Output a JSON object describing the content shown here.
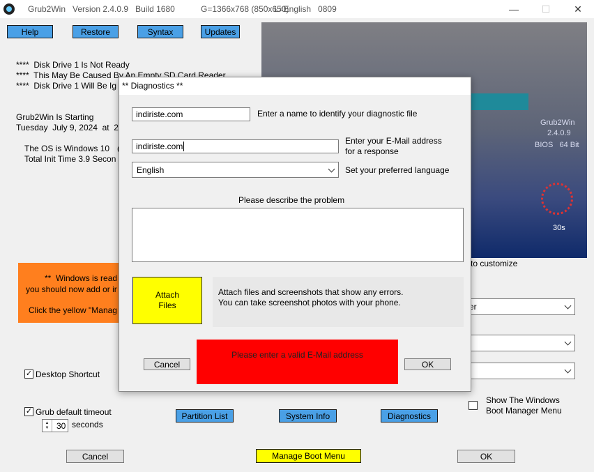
{
  "window": {
    "title": "Grub2Win   Version 2.4.0.9   Build 1680",
    "geometry": "G=1366x768 (850x650)",
    "language": "L=English   0809",
    "minimize_glyph": "—",
    "maximize_glyph": "☐",
    "close_glyph": "✕"
  },
  "toolbar": {
    "help": "Help",
    "restore": "Restore",
    "syntax": "Syntax",
    "updates": "Updates"
  },
  "log": {
    "line1": "****  Disk Drive 1 Is Not Ready",
    "line2": "****  This May Be Caused By An Empty SD Card Reader",
    "line3": "****  Disk Drive 1 Will Be Ig",
    "line4": "Grub2Win Is Starting",
    "line5": "Tuesday  July 9, 2024  at  2",
    "line6": "The OS is Windows 10",
    "line6b": "(",
    "line7": "Total Init Time 3.9 Secon"
  },
  "preview": {
    "name": "Grub2Win",
    "version": "2.4.0.9",
    "bios": "BIOS   64 Bit",
    "timer": "30s"
  },
  "customize_text": "to customize",
  "orange": {
    "line1": "**  Windows is read",
    "line2": "you should now add or ir",
    "line3": "Click the yellow \"Manag"
  },
  "right_selects": {
    "s1": "er",
    "s2": "",
    "s3": ""
  },
  "options": {
    "desktop_shortcut": "Desktop Shortcut",
    "desktop_shortcut_checked": "✓",
    "grub_timeout": "Grub default timeout",
    "grub_timeout_checked": "✓",
    "timeout_value": "30",
    "seconds": "seconds",
    "show_boot_manager_1": "Show The Windows",
    "show_boot_manager_2": "Boot Manager Menu"
  },
  "bottom": {
    "partition_list": "Partition List",
    "system_info": "System Info",
    "diagnostics": "Diagnostics",
    "cancel": "Cancel",
    "manage_boot_menu": "Manage Boot Menu",
    "ok": "OK"
  },
  "dialog": {
    "title": "** Diagnostics **",
    "name_value": "indiriste.com",
    "name_label": "Enter a name to identify your diagnostic file",
    "email_value": "indiriste.com",
    "email_label_1": "Enter your E-Mail address",
    "email_label_2": "for a response",
    "language_value": "English",
    "language_label": "Set your preferred language",
    "describe_label": "Please describe the problem",
    "attach_1": "Attach",
    "attach_2": "Files",
    "attach_info_1": "Attach files and screenshots that show any errors.",
    "attach_info_2": "You can take screenshot photos with your phone.",
    "cancel": "Cancel",
    "error": "Please enter a valid E-Mail address",
    "ok": "OK"
  },
  "colors": {
    "blue_button": "#4aa0e6",
    "yellow_button": "#ffff00",
    "error_red": "#ff0000",
    "orange_banner": "#ff7f1e"
  }
}
